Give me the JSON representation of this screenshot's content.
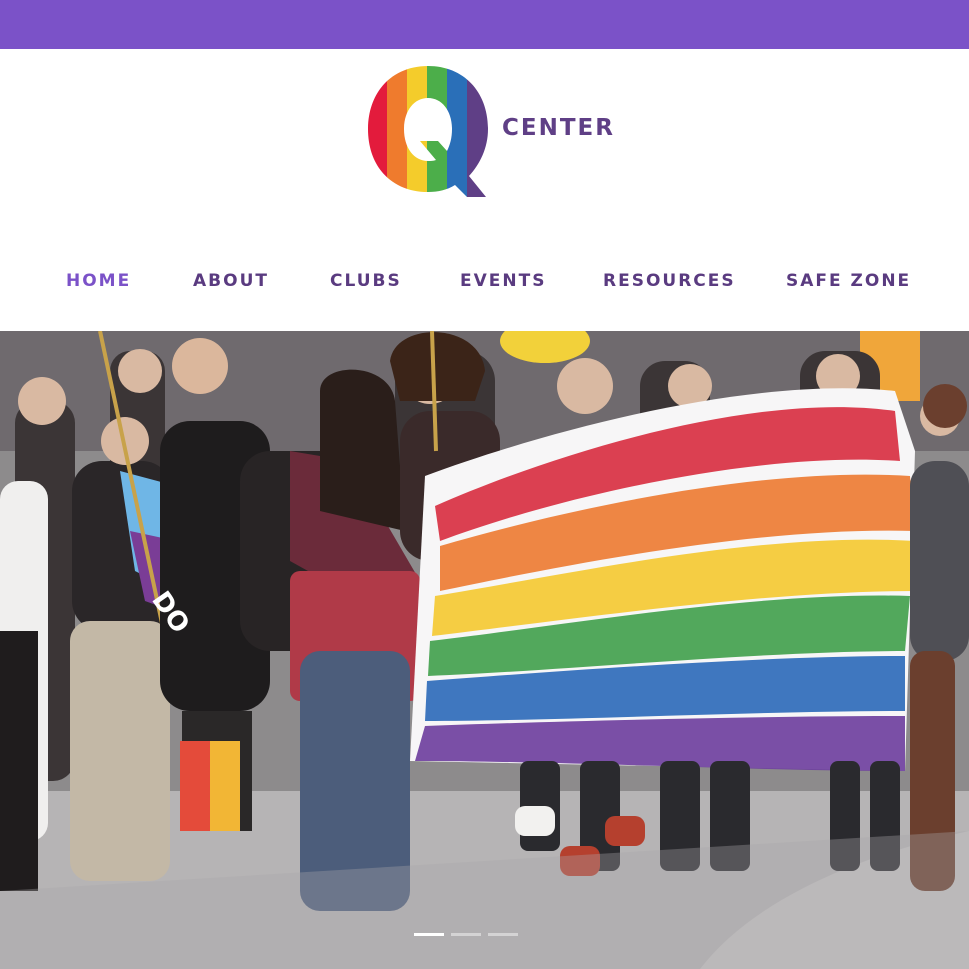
{
  "brand": {
    "logo_letter": "Q",
    "wordmark": "CENTER",
    "colors": {
      "top_bar": "#7b52c8",
      "nav_text": "#5a3b80",
      "nav_active": "#7b52c8",
      "rainbow": [
        "#e31b3c",
        "#ef7b2d",
        "#f4cc2b",
        "#4cae4a",
        "#2a6fb8",
        "#5f3f86"
      ]
    }
  },
  "nav": {
    "items": [
      {
        "label": "HOME",
        "active": true
      },
      {
        "label": "ABOUT",
        "active": false
      },
      {
        "label": "CLUBS",
        "active": false
      },
      {
        "label": "EVENTS",
        "active": false
      },
      {
        "label": "RESOURCES",
        "active": false
      },
      {
        "label": "SAFE ZONE",
        "active": false
      }
    ]
  },
  "hero": {
    "description_icon": "photo-pride-march-with-handprint-rainbow-banner",
    "banner_text_partial": "DO",
    "slider": {
      "slide_count": 3,
      "active_index": 0
    }
  }
}
